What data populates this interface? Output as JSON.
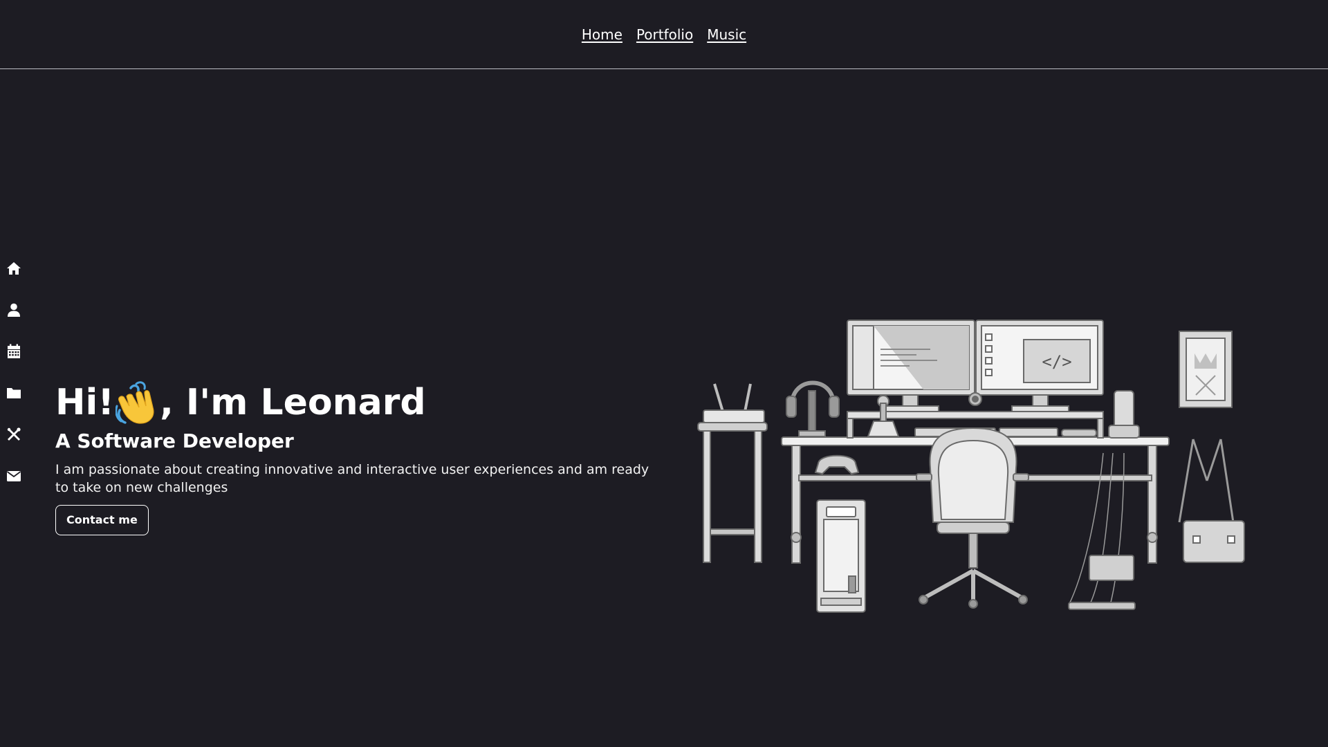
{
  "nav": {
    "links": [
      {
        "label": "Home"
      },
      {
        "label": "Portfolio"
      },
      {
        "label": "Music"
      }
    ]
  },
  "sidebar": {
    "icons": [
      "home-icon",
      "user-icon",
      "calendar-icon",
      "folder-icon",
      "tools-icon",
      "mail-icon"
    ]
  },
  "hero": {
    "greeting_before": "Hi!",
    "greeting_after": ", I'm Leonard",
    "subtitle": "A Software Developer",
    "description": "I am passionate about creating innovative and interactive user experiences and am ready to take on new challenges",
    "cta_label": "Contact me"
  },
  "colors": {
    "background": "#1d1c23",
    "text": "#ffffff",
    "divider": "#bdbdc4"
  }
}
